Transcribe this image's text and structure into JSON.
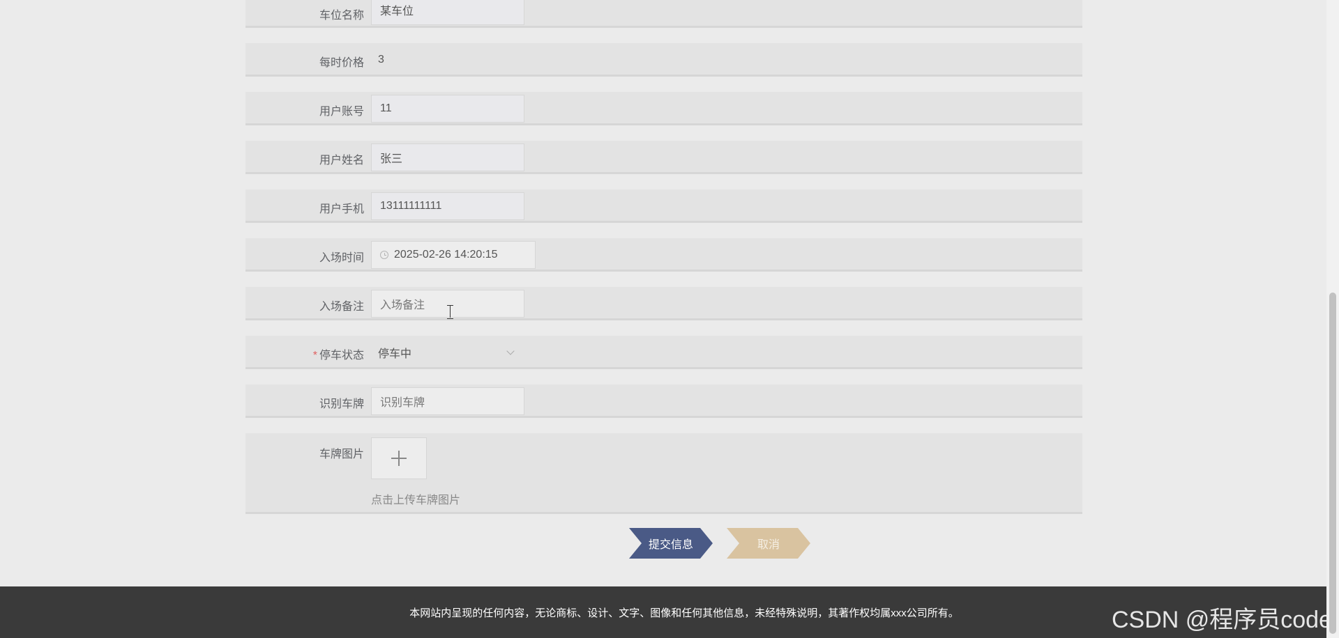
{
  "form": {
    "fields": {
      "space_name": {
        "label": "车位名称",
        "value": "某车位"
      },
      "hourly_price": {
        "label": "每时价格",
        "value": "3"
      },
      "user_account": {
        "label": "用户账号",
        "value": "11"
      },
      "user_name": {
        "label": "用户姓名",
        "value": "张三"
      },
      "user_phone": {
        "label": "用户手机",
        "value": "13111111111"
      },
      "entry_time": {
        "label": "入场时间",
        "value": "2025-02-26 14:20:15",
        "icon": "clock-icon"
      },
      "entry_note": {
        "label": "入场备注",
        "placeholder": "入场备注"
      },
      "parking_status": {
        "required_mark": "*",
        "label": "停车状态",
        "value": "停车中",
        "icon": "chevron-down-icon"
      },
      "plate_number": {
        "label": "识别车牌",
        "placeholder": "识别车牌"
      },
      "plate_image": {
        "label": "车牌图片",
        "hint": "点击上传车牌图片",
        "icon": "plus-icon"
      }
    }
  },
  "actions": {
    "submit_label": "提交信息",
    "cancel_label": "取消"
  },
  "footer": {
    "text": "本网站内呈现的任何内容，无论商标、设计、文字、图像和任何其他信息，未经特殊说明，其著作权均属xxx公司所有。"
  },
  "watermark": "CSDN @程序员code",
  "colors": {
    "submit": "#4a5a86",
    "cancel": "#d9c3a0",
    "footer_bg": "#3a3a3a",
    "required": "#e06060"
  }
}
